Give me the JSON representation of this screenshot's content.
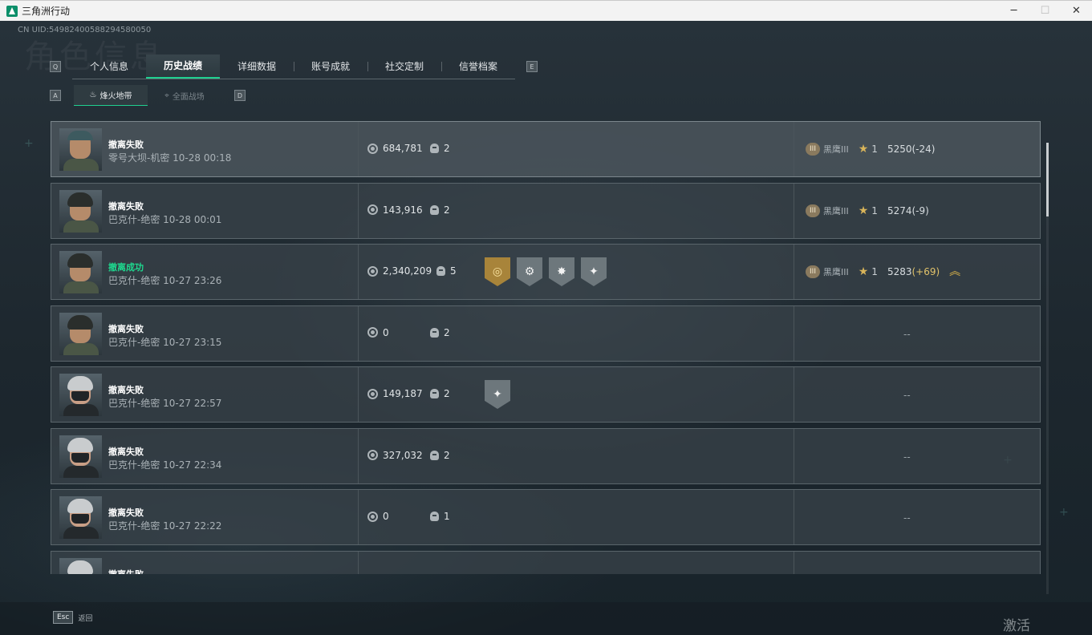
{
  "window": {
    "title": "三角洲行动",
    "controls": {
      "minimize": "─",
      "maximize": "☐",
      "close": "✕"
    }
  },
  "header": {
    "uid": "CN UID:549824005882945800​50",
    "watermark": "角色信息"
  },
  "tabs": {
    "left_key": "Q",
    "right_key": "E",
    "items": [
      {
        "label": "个人信息",
        "active": false
      },
      {
        "label": "历史战绩",
        "active": true
      },
      {
        "label": "详细数据",
        "active": false
      },
      {
        "label": "账号成就",
        "active": false
      },
      {
        "label": "社交定制",
        "active": false
      },
      {
        "label": "信誉档案",
        "active": false
      }
    ]
  },
  "subtabs": {
    "left_key": "A",
    "right_key": "D",
    "items": [
      {
        "label": "烽火地带",
        "icon": "beacon-icon",
        "active": true
      },
      {
        "label": "全面战场",
        "icon": "crosshair-icon",
        "active": false
      }
    ]
  },
  "matches": [
    {
      "status": "撤离失败",
      "result": "fail",
      "map": "零号大坝-机密 10-28 00:18",
      "money": "684,781",
      "kills": "2",
      "badges": [],
      "rank": "黑鹰III",
      "stars": "1",
      "score": "5250",
      "delta": "(-24)",
      "avatar": "a0"
    },
    {
      "status": "撤离失败",
      "result": "fail",
      "map": "巴克什-绝密 10-28 00:01",
      "money": "143,916",
      "kills": "2",
      "badges": [],
      "rank": "黑鹰III",
      "stars": "1",
      "score": "5274",
      "delta": "(-9)",
      "avatar": "a1"
    },
    {
      "status": "撤离成功",
      "result": "win",
      "map": "巴克什-绝密 10-27 23:26",
      "money": "2,340,209",
      "kills": "5",
      "badges": [
        "medal-gold-icon",
        "wrench-icon",
        "burst-icon",
        "handshake-icon"
      ],
      "rank": "黑鹰III",
      "stars": "1",
      "score": "5283",
      "delta": "(+69)",
      "avatar": "a1"
    },
    {
      "status": "撤离失败",
      "result": "fail",
      "map": "巴克什-绝密 10-27 23:15",
      "money": "0",
      "kills": "2",
      "badges": [],
      "rank": "",
      "stars": "",
      "score": "",
      "delta": "",
      "placeholder": "--",
      "avatar": "a1"
    },
    {
      "status": "撤离失败",
      "result": "fail",
      "map": "巴克什-绝密 10-27 22:57",
      "money": "149,187",
      "kills": "2",
      "badges": [
        "handshake-icon"
      ],
      "rank": "",
      "stars": "",
      "score": "",
      "delta": "",
      "placeholder": "--",
      "avatar": "a2"
    },
    {
      "status": "撤离失败",
      "result": "fail",
      "map": "巴克什-绝密 10-27 22:34",
      "money": "327,032",
      "kills": "2",
      "badges": [],
      "rank": "",
      "stars": "",
      "score": "",
      "delta": "",
      "placeholder": "--",
      "avatar": "a2"
    },
    {
      "status": "撤离失败",
      "result": "fail",
      "map": "巴克什-绝密 10-27 22:22",
      "money": "0",
      "kills": "1",
      "badges": [],
      "rank": "",
      "stars": "",
      "score": "",
      "delta": "",
      "placeholder": "--",
      "avatar": "a2"
    },
    {
      "status": "撤离失败",
      "result": "fail",
      "map": "",
      "money": "",
      "kills": "",
      "badges": [],
      "rank": "",
      "stars": "",
      "score": "",
      "delta": "",
      "avatar": "a2"
    }
  ],
  "footer": {
    "esc_key": "Esc",
    "back_label": "返回",
    "activate_windows": "激活 Windows"
  },
  "colors": {
    "accent_green": "#1fd08f",
    "win_text": "#1ed98f",
    "gold": "#e2c36a"
  }
}
